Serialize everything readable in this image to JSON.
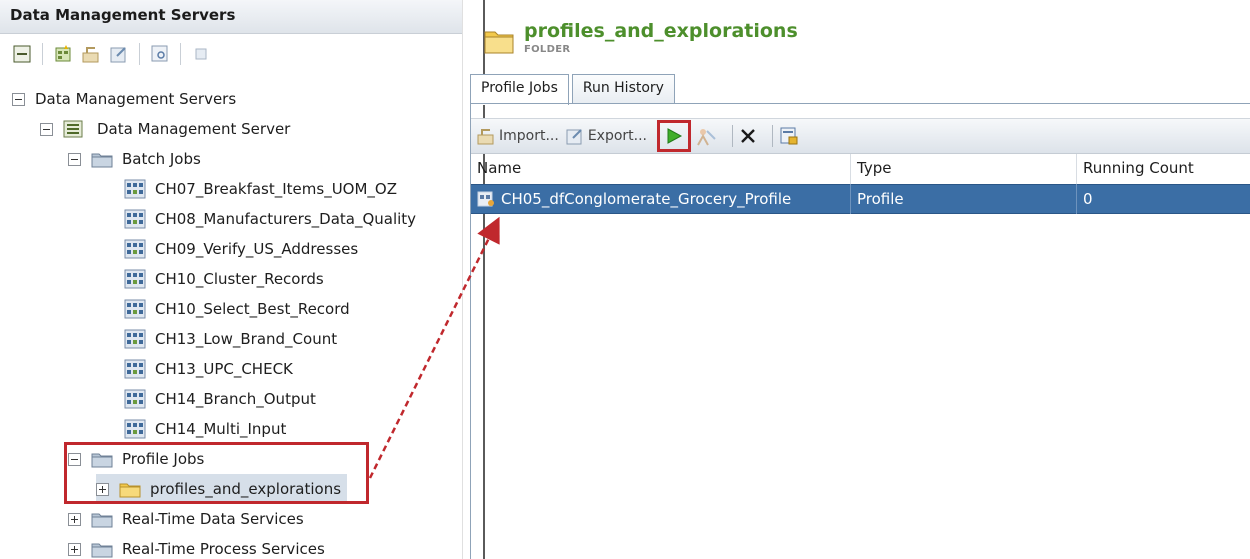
{
  "left_panel": {
    "header_title": "Data Management Servers",
    "toolbar_icons": [
      "collapse-all-icon",
      "new-job-icon",
      "import-icon",
      "export-icon",
      "find-icon",
      "copy-icon"
    ],
    "tree": {
      "root": "Data Management Servers",
      "server": "Data Management Server",
      "batch_jobs": {
        "label": "Batch Jobs",
        "items": [
          "CH07_Breakfast_Items_UOM_OZ",
          "CH08_Manufacturers_Data_Quality",
          "CH09_Verify_US_Addresses",
          "CH10_Cluster_Records",
          "CH10_Select_Best_Record",
          "CH13_Low_Brand_Count",
          "CH13_UPC_CHECK",
          "CH14_Branch_Output",
          "CH14_Multi_Input"
        ]
      },
      "profile_jobs": {
        "label": "Profile Jobs",
        "child": "profiles_and_explorations"
      },
      "real_time_data": "Real-Time Data Services",
      "real_time_process": "Real-Time Process Services"
    }
  },
  "right_panel": {
    "title": "profiles_and_explorations",
    "subtitle": "FOLDER",
    "tabs": [
      {
        "label": "Profile Jobs",
        "active": true
      },
      {
        "label": "Run History",
        "active": false
      }
    ],
    "toolbar": {
      "import_label": "Import...",
      "export_label": "Export..."
    },
    "columns": [
      "Name",
      "Type",
      "Running Count"
    ],
    "rows": [
      {
        "name": "CH05_dfConglomerate_Grocery_Profile",
        "type": "Profile",
        "running_count": "0"
      }
    ]
  },
  "colors": {
    "title_green": "#4d8f2c",
    "highlight_red": "#c0282d",
    "selection_blue": "#3b6ea5"
  }
}
